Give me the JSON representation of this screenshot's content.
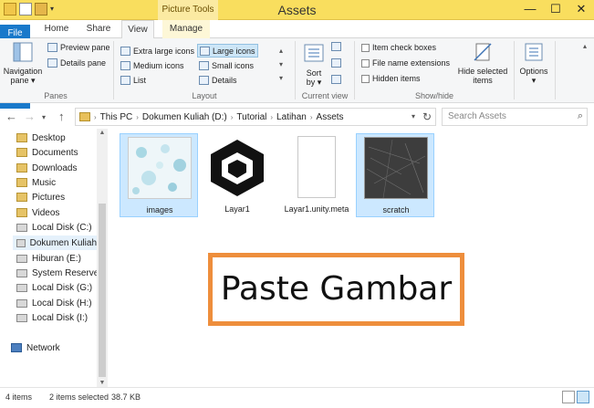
{
  "window": {
    "title": "Assets",
    "context_tab": "Picture Tools",
    "minimize": "—",
    "maximize": "☐",
    "close": "✕"
  },
  "tabs": {
    "file": "File",
    "home": "Home",
    "share": "Share",
    "view": "View",
    "manage": "Manage"
  },
  "ribbon": {
    "panes": {
      "navigation_pane": "Navigation\npane ▾",
      "preview_pane": "Preview pane",
      "details_pane": "Details pane",
      "label": "Panes"
    },
    "layout": {
      "extra_large": "Extra large icons",
      "large": "Large icons",
      "medium": "Medium icons",
      "small": "Small icons",
      "list": "List",
      "details": "Details",
      "label": "Layout",
      "selected": "Large icons"
    },
    "current_view": {
      "sort_by": "Sort\nby ▾",
      "label": "Current view"
    },
    "show_hide": {
      "item_check_boxes": "Item check boxes",
      "file_name_extensions": "File name extensions",
      "hidden_items": "Hidden items",
      "hide_selected": "Hide selected\nitems",
      "label": "Show/hide"
    },
    "options": "Options\n▾"
  },
  "address": {
    "path": [
      "This PC",
      "Dokumen Kuliah (D:)",
      "Tutorial",
      "Latihan",
      "Assets"
    ],
    "search_placeholder": "Search Assets"
  },
  "nav": {
    "items": [
      {
        "label": "Desktop",
        "icon": "folder-icon"
      },
      {
        "label": "Documents",
        "icon": "folder-icon"
      },
      {
        "label": "Downloads",
        "icon": "folder-icon"
      },
      {
        "label": "Music",
        "icon": "folder-icon"
      },
      {
        "label": "Pictures",
        "icon": "folder-icon"
      },
      {
        "label": "Videos",
        "icon": "folder-icon"
      },
      {
        "label": "Local Disk (C:)",
        "icon": "drive-icon"
      },
      {
        "label": "Dokumen Kuliah",
        "icon": "drive-icon"
      },
      {
        "label": "Hiburan (E:)",
        "icon": "drive-icon"
      },
      {
        "label": "System Reserved",
        "icon": "drive-icon"
      },
      {
        "label": "Local Disk (G:)",
        "icon": "drive-icon"
      },
      {
        "label": "Local Disk (H:)",
        "icon": "drive-icon"
      },
      {
        "label": "Local Disk (I:)",
        "icon": "drive-icon"
      }
    ],
    "network": "Network"
  },
  "files": [
    {
      "name": "images",
      "selected": true,
      "type": "image"
    },
    {
      "name": "Layar1",
      "selected": false,
      "type": "unity"
    },
    {
      "name": "Layar1.unity.meta",
      "selected": false,
      "type": "document"
    },
    {
      "name": "scratch",
      "selected": true,
      "type": "image"
    }
  ],
  "overlay": {
    "text": "Paste Gambar",
    "border_color": "#ee8e3c"
  },
  "status": {
    "count": "4 items",
    "selection": "2 items selected",
    "size": "38.7 KB"
  },
  "colors": {
    "title_bar": "#f9de5e",
    "file_tab": "#1979ca",
    "selection": "#cce8ff"
  }
}
